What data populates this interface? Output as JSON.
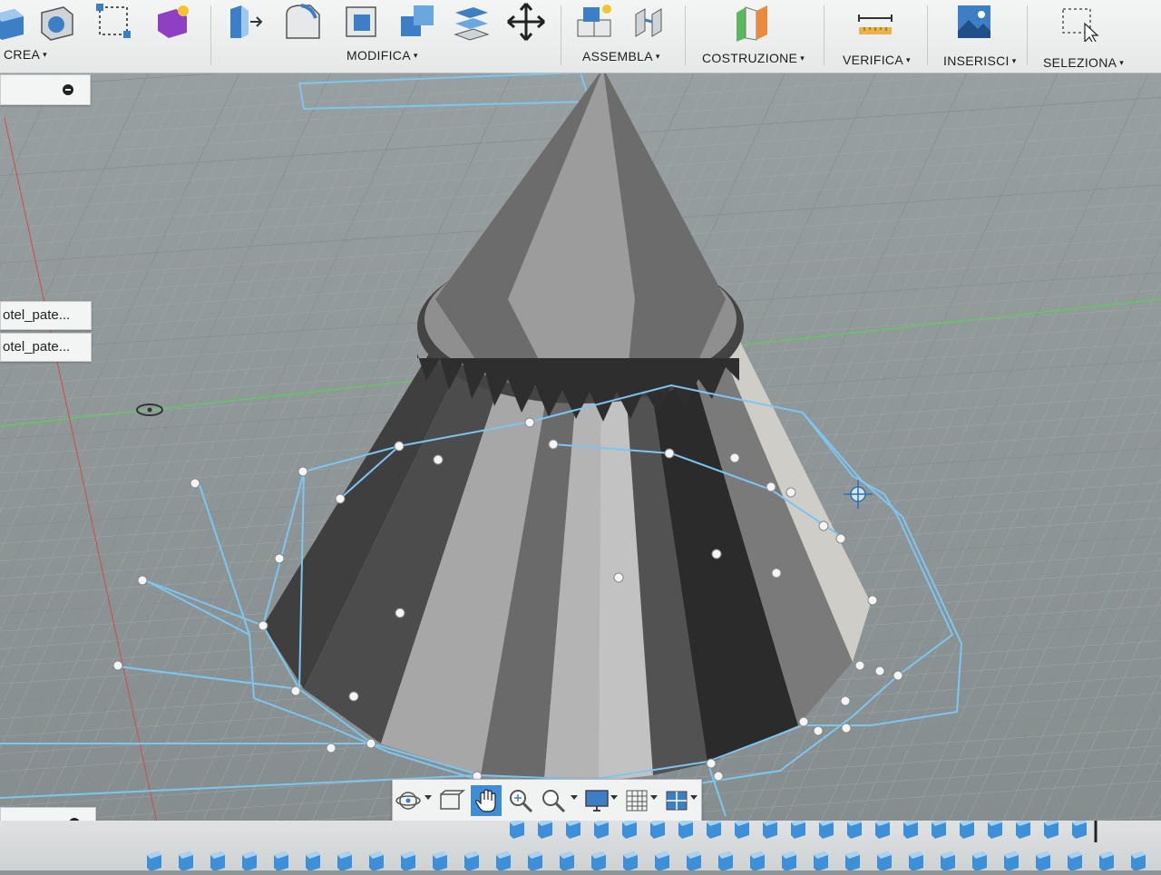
{
  "toolbar": {
    "groups": [
      {
        "label": "CREA"
      },
      {
        "label": "MODIFICA"
      },
      {
        "label": "ASSEMBLA"
      },
      {
        "label": "COSTRUZIONE"
      },
      {
        "label": "VERIFICA"
      },
      {
        "label": "INSERISCI"
      },
      {
        "label": "SELEZIONA"
      }
    ],
    "caret": "▾"
  },
  "browser": {
    "items": [
      {
        "label": "otel_pate..."
      },
      {
        "label": "otel_pate..."
      }
    ]
  },
  "navbar": {
    "tools": [
      "orbit-icon",
      "look-at-icon",
      "pan-icon",
      "zoom-icon",
      "fit-icon",
      "display-settings-icon",
      "grid-settings-icon",
      "viewports-icon"
    ],
    "active": "pan-icon"
  },
  "colors": {
    "sketch": "#7cc6f0",
    "accent": "#3c8fd6",
    "toolbar_bg": "#eceeee",
    "grid": "#a4aaab"
  }
}
